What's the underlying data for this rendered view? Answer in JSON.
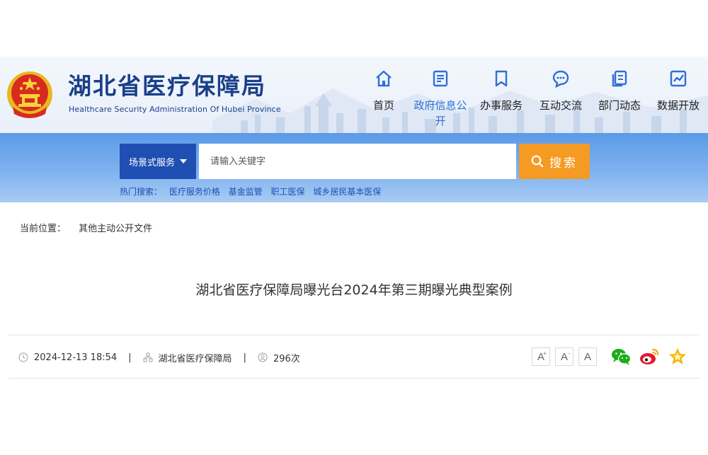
{
  "header": {
    "title": "湖北省医疗保障局",
    "subtitle": "Healthcare Security Administration Of Hubei Province",
    "nav": [
      {
        "label": "首页",
        "icon": "home-icon"
      },
      {
        "label": "政府信息公开",
        "icon": "document-icon"
      },
      {
        "label": "办事服务",
        "icon": "bookmark-icon"
      },
      {
        "label": "互动交流",
        "icon": "chat-icon"
      },
      {
        "label": "部门动态",
        "icon": "copy-icon"
      },
      {
        "label": "数据开放",
        "icon": "chart-icon"
      }
    ],
    "active_nav": 1
  },
  "search": {
    "scene_label": "场景式服务",
    "placeholder": "请输入关键字",
    "button_label": "搜索",
    "hot_label": "热门搜索：",
    "hot_terms": [
      "医疗服务价格",
      "基金监管",
      "职工医保",
      "城乡居民基本医保"
    ]
  },
  "breadcrumb": {
    "label": "当前位置：",
    "current": "其他主动公开文件"
  },
  "article": {
    "title": "湖北省医疗保障局曝光台2024年第三期曝光典型案例",
    "date": "2024-12-13 18:54",
    "source": "湖北省医疗保障局",
    "views": "296次",
    "separator": "|"
  },
  "tools": {
    "font_larger": "A",
    "font_larger_mark": "+",
    "font_smaller": "A",
    "font_smaller_mark": "-",
    "font_default": "A"
  },
  "colors": {
    "brand_blue": "#1a3f8a",
    "nav_active": "#2f6fd6",
    "scene_btn": "#1f4fb3",
    "search_btn": "#f59a23",
    "wechat": "#1aad19",
    "weibo": "#e6162d",
    "favorite": "#f5b800"
  }
}
